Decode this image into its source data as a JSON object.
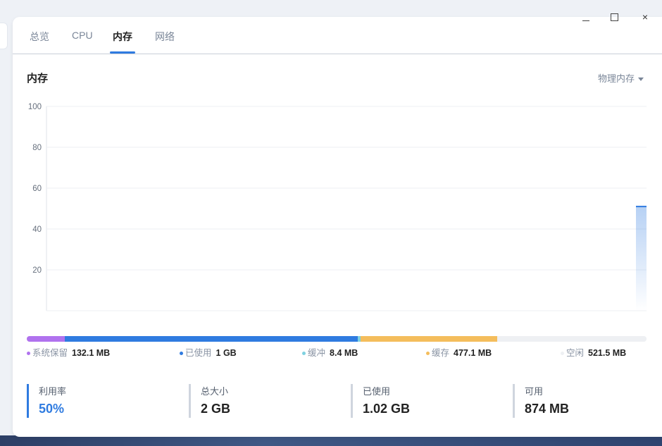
{
  "window": {
    "controls": {
      "minimize": "−",
      "maximize": "□",
      "close": "×"
    }
  },
  "tabs": [
    {
      "label": "总览"
    },
    {
      "label": "CPU"
    },
    {
      "label": "内存",
      "active": true
    },
    {
      "label": "网络"
    }
  ],
  "section": {
    "title": "内存",
    "dropdown_label": "物理内存"
  },
  "chart_data": {
    "type": "area",
    "yticks": [
      "100",
      "80",
      "60",
      "40",
      "20"
    ],
    "ylim": [
      0,
      100
    ],
    "series": [
      {
        "values": [
          51
        ]
      }
    ],
    "color": "#2f7be0"
  },
  "memory_bar": [
    {
      "name": "系统保留",
      "value": "132.1 MB",
      "mb": 132.1,
      "color": "#b072ee"
    },
    {
      "name": "已使用",
      "value": "1 GB",
      "mb": 1024,
      "color": "#2f7be0"
    },
    {
      "name": "缓冲",
      "value": "8.4 MB",
      "mb": 8.4,
      "color": "#7fd1e0"
    },
    {
      "name": "缓存",
      "value": "477.1 MB",
      "mb": 477.1,
      "color": "#f4bd5c"
    },
    {
      "name": "空闲",
      "value": "521.5 MB",
      "mb": 521.5,
      "color": "#eef0f3"
    }
  ],
  "stats": [
    {
      "label": "利用率",
      "value": "50%"
    },
    {
      "label": "总大小",
      "value": "2 GB"
    },
    {
      "label": "已使用",
      "value": "1.02 GB"
    },
    {
      "label": "可用",
      "value": "874 MB"
    }
  ]
}
